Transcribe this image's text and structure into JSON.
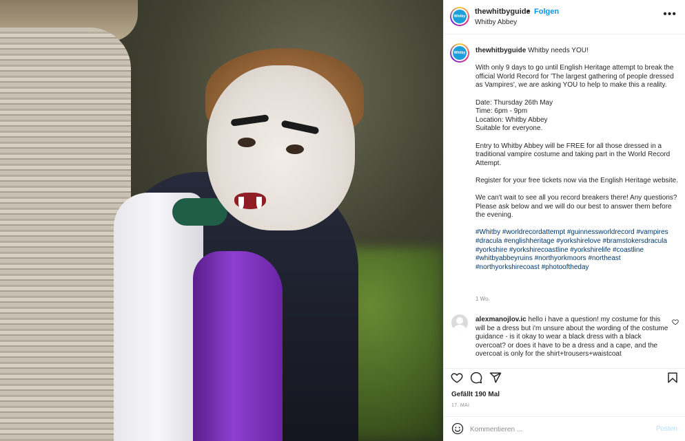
{
  "post": {
    "username": "thewhitbyguide",
    "separator": "•",
    "follow_label": "Folgen",
    "location": "Whitby Abbey",
    "avatar_text": "Whitby",
    "more_icon": "more-horizontal-icon"
  },
  "caption": {
    "username": "thewhitbyguide",
    "intro": "Whitby needs YOU!",
    "p1": "With only 9 days to go until English Heritage attempt to break the official World Record for 'The largest gathering of people dressed as Vampires', we are asking YOU to help to make this a reality.",
    "details": [
      "Date: Thursday 26th May",
      "Time: 6pm - 9pm",
      "Location: Whitby Abbey",
      "Suitable for everyone."
    ],
    "p2": "Entry to Whitby Abbey will be FREE for all those dressed in a traditional vampire costume and taking part in the World Record Attempt.",
    "p3": "Register for your free tickets now via the English Heritage website.",
    "p4": "We can't wait to see all you record breakers there! Any questions? Please ask below and we will do our best to answer them before the evening.",
    "hashtags": "#Whitby #worldrecordattempt #guinnessworldrecord #vampires #dracula #englishheritage #yorkshirelove #bramstokersdracula #yorkshire #yorkshirecoastline #yorkshirelife #coastline #whitbyabbeyruins #northyorkmoors #northeast #northyorkshirecoast #photooftheday",
    "time_ago": "1 Wo."
  },
  "comment": {
    "username": "alexmanojlov.ic",
    "text": "hello i have a question! my costume for this will be a dress but i'm unsure about the wording of the costume guidance - is it okay to wear a black dress with a black overcoat? or does it have to be a dress and a cape, and the overcoat is only for the shirt+trousers+waistcoat"
  },
  "actions": {
    "icons": [
      "heart-icon",
      "comment-icon",
      "share-icon",
      "bookmark-icon"
    ],
    "likes": "Gefällt 190 Mal",
    "date": "17. MAI"
  },
  "comment_box": {
    "placeholder": "Kommentieren ...",
    "post_label": "Posten",
    "emoji_icon": "emoji-icon"
  },
  "colors": {
    "accent": "#0095f6",
    "hashtag": "#00376b",
    "muted": "#8e8e8e",
    "post_disabled": "#b2dffc"
  }
}
